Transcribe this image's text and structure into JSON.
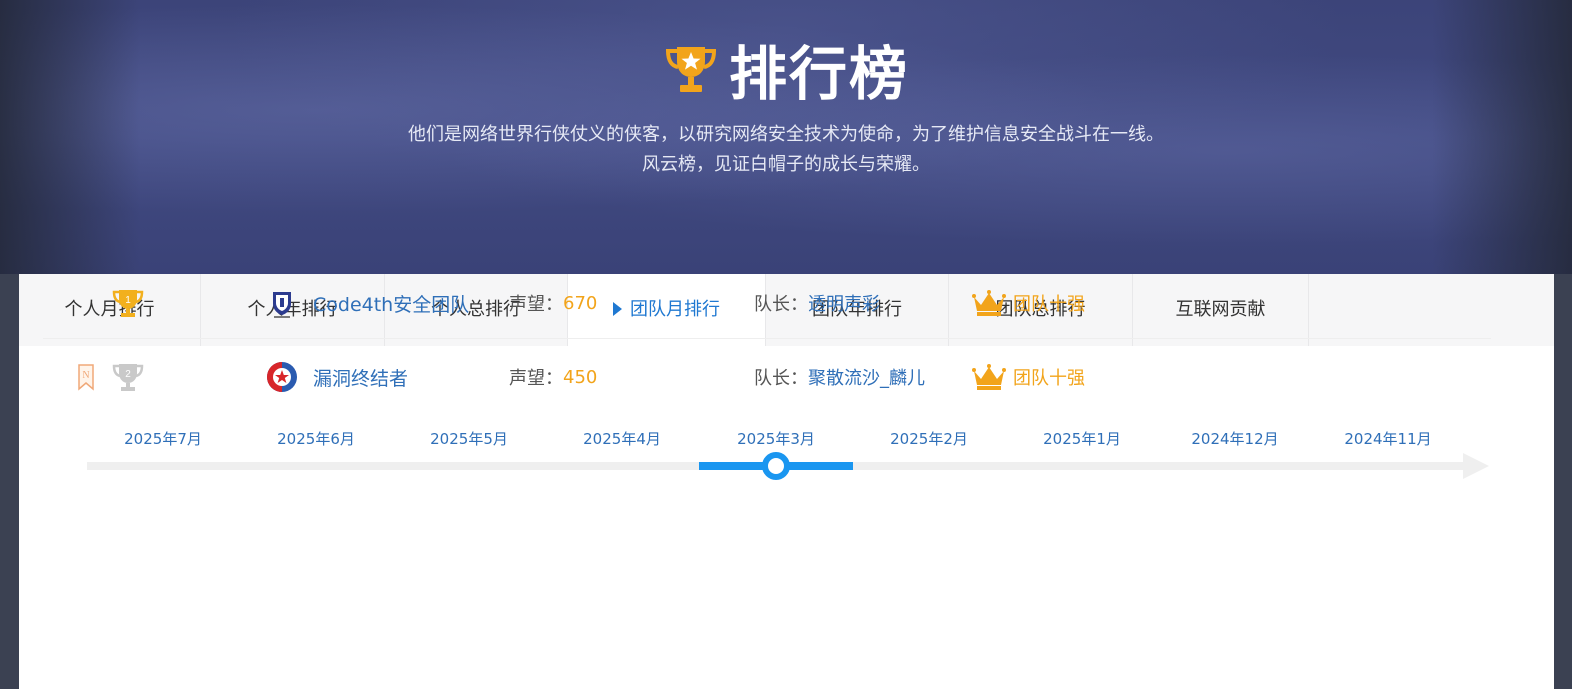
{
  "hero": {
    "title": "排行榜",
    "subtitle_line1": "他们是网络世界行侠仗义的侠客，以研究网络安全技术为使命，为了维护信息安全战斗在一线。",
    "subtitle_line2": "风云榜，见证白帽子的成长与荣耀。",
    "trophy_icon": "trophy-icon"
  },
  "tabs": [
    {
      "label": "个人月排行",
      "active": false
    },
    {
      "label": "个人年排行",
      "active": false
    },
    {
      "label": "个人总排行",
      "active": false
    },
    {
      "label": "团队月排行",
      "active": true
    },
    {
      "label": "团队年排行",
      "active": false
    },
    {
      "label": "团队总排行",
      "active": false
    },
    {
      "label": "互联网贡献",
      "active": false
    }
  ],
  "timeline": {
    "months": [
      "2025年7月",
      "2025年6月",
      "2025年5月",
      "2025年4月",
      "2025年3月",
      "2025年2月",
      "2025年1月",
      "2024年12月",
      "2024年11月"
    ],
    "selected": "2025年3月"
  },
  "ranking": [
    {
      "rank": "1",
      "team_name": "Code4th安全团队",
      "reputation_label": "声望：",
      "reputation": "670",
      "captain_label": "队长：",
      "captain": "透明声彩",
      "badge": "团队十强"
    },
    {
      "rank": "2",
      "flag": "N",
      "team_name": "漏洞终结者",
      "reputation_label": "声望：",
      "reputation": "450",
      "captain_label": "队长：",
      "captain": "聚散流沙_麟儿",
      "badge": "团队十强"
    }
  ],
  "colors": {
    "link_blue": "#2f6fb8",
    "active_tab": "#1f78d1",
    "timeline_active": "#1a96f0",
    "gold": "#f2a41b",
    "hero_navy": "#414a82"
  }
}
